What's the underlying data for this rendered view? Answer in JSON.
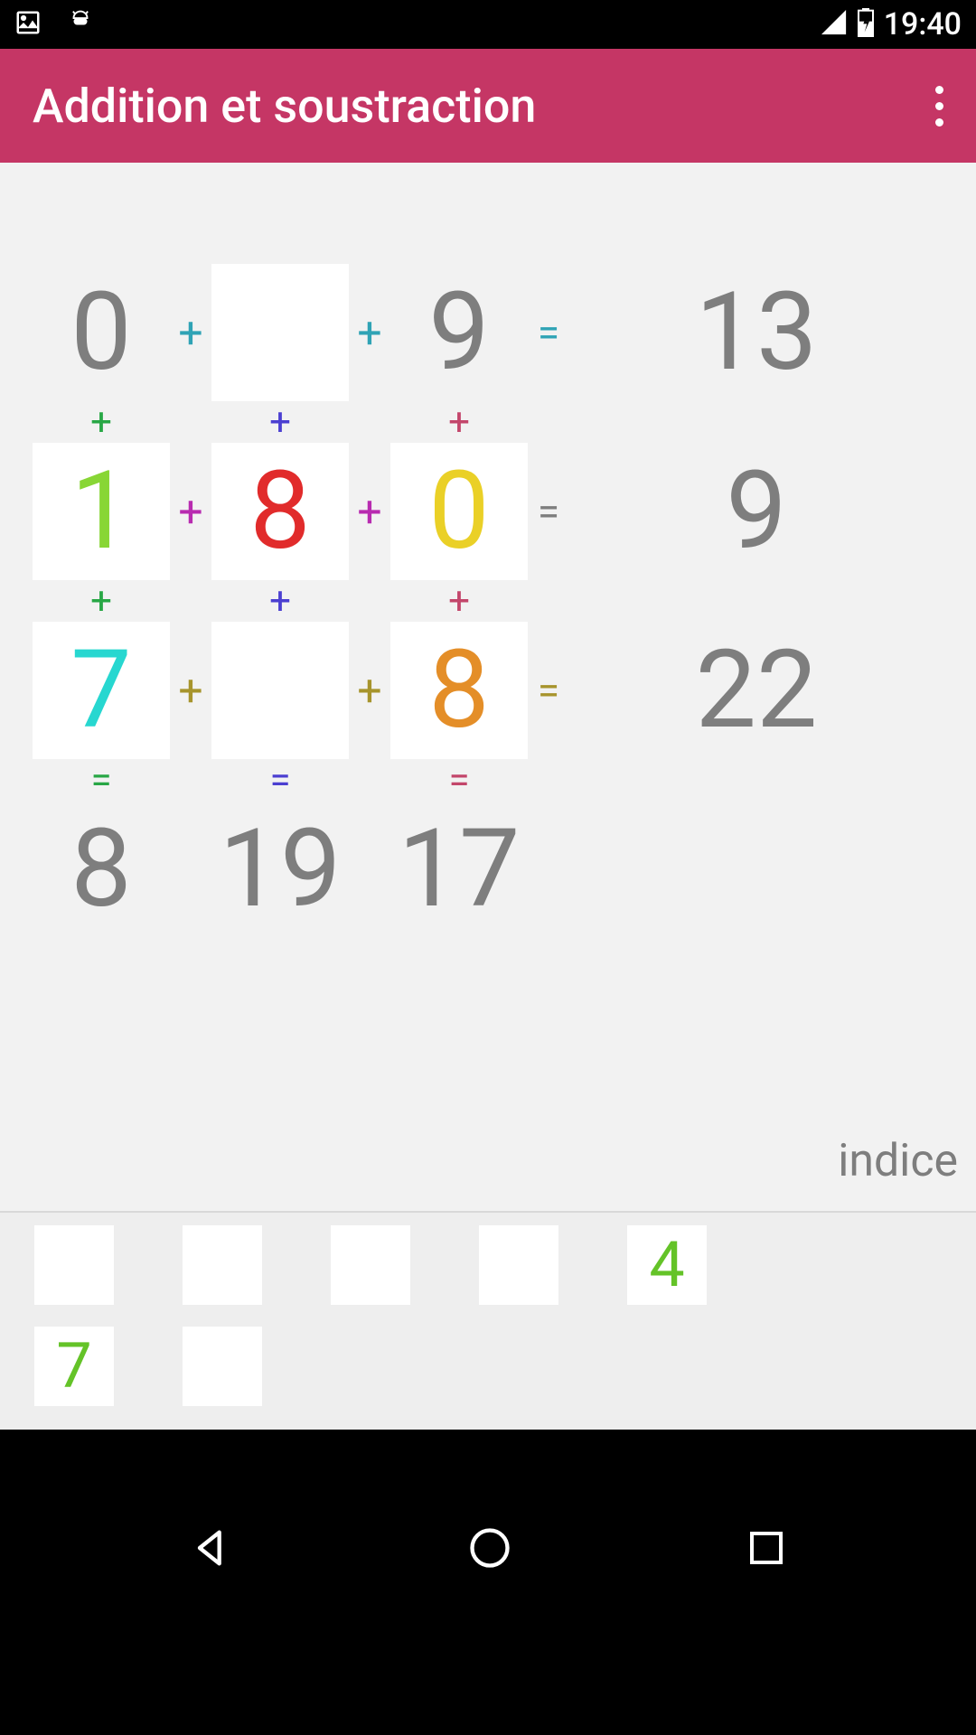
{
  "status": {
    "time": "19:40"
  },
  "app": {
    "title": "Addition et soustraction"
  },
  "colors": {
    "teal": "#2fa3b5",
    "green": "#28a745",
    "lime": "#88d635",
    "blue": "#4b3fd1",
    "cyan": "#27d7d0",
    "red": "#e12b2b",
    "magenta": "#b82bb0",
    "yellow": "#ead027",
    "olive": "#a7942c",
    "orange": "#e48e28",
    "pink": "#c3466b",
    "grey": "#7e7e7e"
  },
  "grid": {
    "rows": [
      {
        "c1": {
          "v": "0",
          "box": false,
          "color": "grey"
        },
        "op1": {
          "t": "+",
          "color": "teal"
        },
        "c2": {
          "v": "",
          "box": true,
          "color": "grey"
        },
        "op2": {
          "t": "+",
          "color": "teal"
        },
        "c3": {
          "v": "9",
          "box": false,
          "color": "grey"
        },
        "eq": {
          "t": "=",
          "color": "teal"
        },
        "res": "13"
      },
      {
        "c1": {
          "v": "1",
          "box": true,
          "color": "lime"
        },
        "op1": {
          "t": "+",
          "color": "magenta"
        },
        "c2": {
          "v": "8",
          "box": true,
          "color": "red"
        },
        "op2": {
          "t": "+",
          "color": "magenta"
        },
        "c3": {
          "v": "0",
          "box": true,
          "color": "yellow"
        },
        "eq": {
          "t": "=",
          "color": "grey"
        },
        "res": "9"
      },
      {
        "c1": {
          "v": "7",
          "box": true,
          "color": "cyan"
        },
        "op1": {
          "t": "+",
          "color": "olive"
        },
        "c2": {
          "v": "",
          "box": true,
          "color": "grey"
        },
        "op2": {
          "t": "+",
          "color": "olive"
        },
        "c3": {
          "v": "8",
          "box": true,
          "color": "orange"
        },
        "eq": {
          "t": "=",
          "color": "olive"
        },
        "res": "22"
      }
    ],
    "vops": [
      [
        {
          "t": "+",
          "color": "green"
        },
        {
          "t": "+",
          "color": "blue"
        },
        {
          "t": "+",
          "color": "pink"
        }
      ],
      [
        {
          "t": "+",
          "color": "green"
        },
        {
          "t": "+",
          "color": "blue"
        },
        {
          "t": "+",
          "color": "pink"
        }
      ],
      [
        {
          "t": "=",
          "color": "green"
        },
        {
          "t": "=",
          "color": "blue"
        },
        {
          "t": "=",
          "color": "pink"
        }
      ]
    ],
    "colResults": [
      "8",
      "19",
      "17"
    ]
  },
  "hint": "indice",
  "tiles": {
    "row1": [
      "",
      "",
      "",
      "",
      "4"
    ],
    "row2": [
      "7",
      ""
    ]
  },
  "tileColors": {
    "4": "#64c328",
    "7": "#64c328"
  }
}
